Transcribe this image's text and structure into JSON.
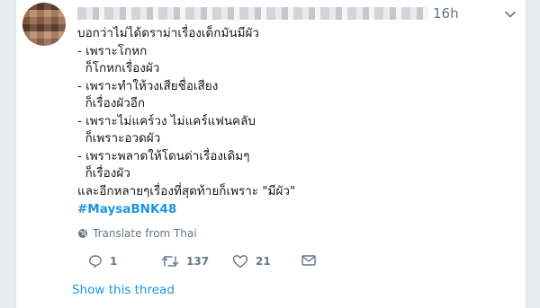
{
  "tweet": {
    "time": "16h",
    "lines": [
      "บอกว่าไม่ได้ดราม่าเรื่องเด็กมันมีผัว",
      "- เพราะโกหก",
      "  ก็โกหกเรื่องผัว",
      "- เพราะทำให้วงเสียชื่อเสียง",
      "  ก็เรื่องผัวอีก",
      "- เพราะไม่แคร์วง ไม่แคร์แฟนคลับ",
      "  ก็เพราะอวดผัว",
      "- เพราะพลาดให้โดนด่าเรื่องเดิมๆ",
      "  ก็เรื่องผัว",
      "และอีกหลายๆเรื่องที่สุดท้ายก็เพราะ \"มีผัว\""
    ],
    "hashtag": "#MaysaBNK48",
    "translate_label": "Translate from Thai",
    "reply_count": "1",
    "retweet_count": "137",
    "like_count": "21",
    "show_thread": "Show this thread"
  },
  "colors": {
    "link": "#1b95e0",
    "muted": "#657786",
    "text": "#14171a"
  }
}
